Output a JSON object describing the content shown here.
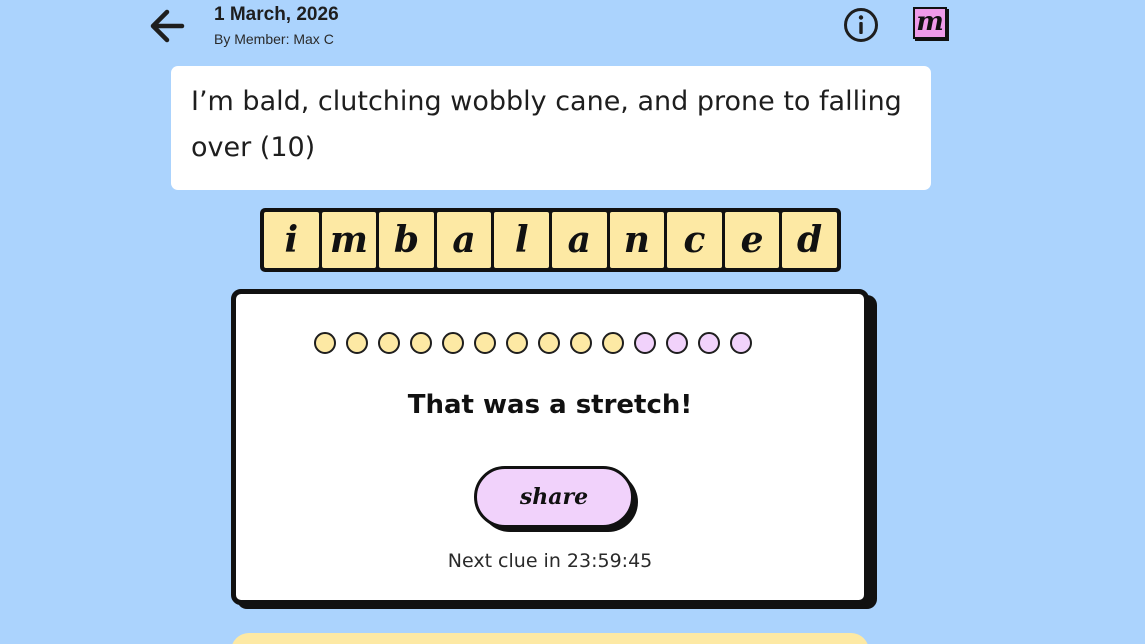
{
  "header": {
    "date": "1 March, 2026",
    "author": "By Member: Max C",
    "logo_letter": "m"
  },
  "clue": {
    "text": "I’m bald, clutching wobbly cane, and prone to falling over (10)"
  },
  "answer": {
    "letters": [
      "i",
      "m",
      "b",
      "a",
      "l",
      "a",
      "n",
      "c",
      "e",
      "d"
    ]
  },
  "result": {
    "dots": [
      {
        "state": "used",
        "color": "#fde9a4"
      },
      {
        "state": "used",
        "color": "#fde9a4"
      },
      {
        "state": "used",
        "color": "#fde9a4"
      },
      {
        "state": "used",
        "color": "#fde9a4"
      },
      {
        "state": "used",
        "color": "#fde9a4"
      },
      {
        "state": "used",
        "color": "#fde9a4"
      },
      {
        "state": "used",
        "color": "#fde9a4"
      },
      {
        "state": "used",
        "color": "#fde9a4"
      },
      {
        "state": "used",
        "color": "#fde9a4"
      },
      {
        "state": "used",
        "color": "#fde9a4"
      },
      {
        "state": "remaining",
        "color": "#f1d2fb"
      },
      {
        "state": "remaining",
        "color": "#f1d2fb"
      },
      {
        "state": "remaining",
        "color": "#f1d2fb"
      },
      {
        "state": "remaining",
        "color": "#f1d2fb"
      }
    ],
    "title": "That was a stretch!",
    "share_label": "share",
    "next_clue": "Next clue in 23:59:45"
  },
  "icons": {
    "back": "arrow-left-icon",
    "info": "info-icon",
    "logo": "logo-icon"
  },
  "colors": {
    "background": "#abd3fd",
    "tile": "#fde9a4",
    "accent_pink": "#f1d2fb",
    "ink": "#111111"
  }
}
